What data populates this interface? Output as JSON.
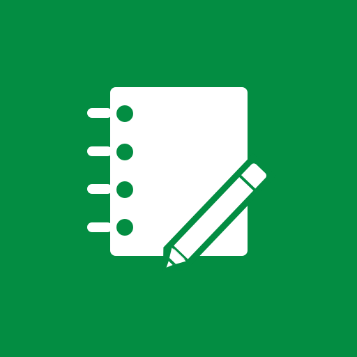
{
  "tile": {
    "icon": "notebook-with-pencil-icon",
    "colors": {
      "background": "#038d42",
      "foreground": "#ffffff"
    }
  }
}
